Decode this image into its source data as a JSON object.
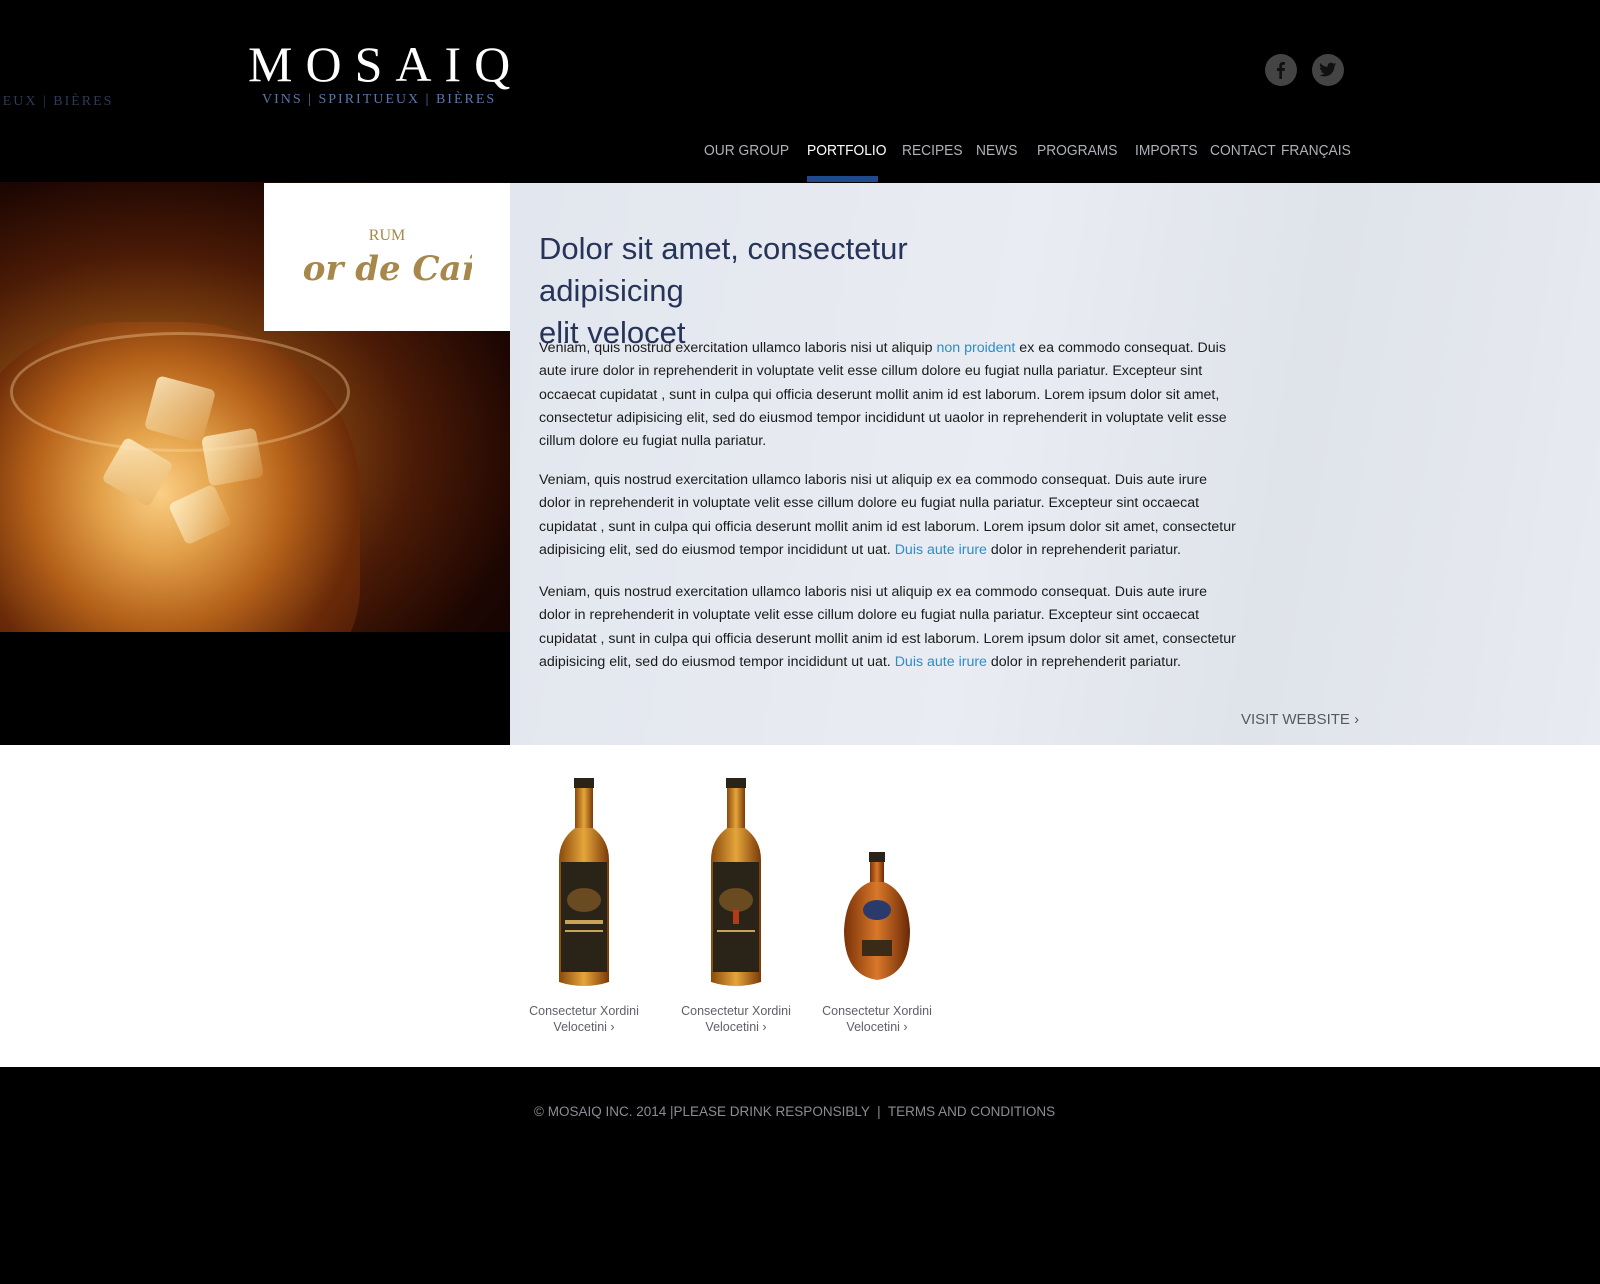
{
  "header": {
    "ghost_tagline": "IEUX | BIÈRES",
    "logo_word": "MOSAIQ",
    "logo_tagline": "VINS | SPIRITUEUX | BIÈRES",
    "social": [
      "facebook-icon",
      "twitter-icon"
    ]
  },
  "nav": {
    "items": [
      "OUR GROUP",
      "PORTFOLIO",
      "RECIPES",
      "NEWS",
      "PROGRAMS",
      "IMPORTS",
      "CONTACT",
      "FRANÇAIS"
    ],
    "active": "PORTFOLIO"
  },
  "brand": {
    "rum_label": "RUM",
    "name": "Flor de Caña",
    "color": "#a8874b"
  },
  "main": {
    "headline_line1": "Dolor sit amet, consectetur adipisicing",
    "headline_line2": "elit velocet",
    "p1_a": "Veniam, quis nostrud exercitation ullamco laboris nisi ut aliquip ",
    "p1_link": "non proident",
    "p1_b": " ex ea commodo consequat. Duis aute irure dolor in reprehenderit in voluptate velit esse cillum dolore eu fugiat nulla pariatur. Excepteur sint occaecat cupidatat , sunt in culpa qui officia deserunt mollit anim id est laborum. Lorem ipsum dolor sit amet, consectetur adipisicing elit, sed do eiusmod tempor incididunt ut uaolor in reprehenderit in voluptate velit esse cillum dolore eu fugiat nulla pariatur.",
    "p2_a": "Veniam, quis nostrud exercitation ullamco laboris nisi ut aliquip ex ea commodo consequat. Duis aute irure dolor in reprehenderit in voluptate velit esse cillum dolore eu fugiat nulla pariatur. Excepteur sint occaecat cupidatat , sunt in culpa qui officia deserunt mollit anim id est laborum. Lorem ipsum dolor sit amet, consectetur adipisicing elit, sed do eiusmod tempor incididunt ut uat. ",
    "p2_link": "Duis aute irure",
    "p2_b": " dolor in reprehenderit pariatur.",
    "p3_a": "Veniam, quis nostrud exercitation ullamco laboris nisi ut aliquip ex ea commodo consequat. Duis aute irure dolor in reprehenderit in voluptate velit esse cillum dolore eu fugiat nulla pariatur. Excepteur sint occaecat cupidatat , sunt in culpa qui officia deserunt mollit anim id est laborum. Lorem ipsum dolor sit amet, consectetur adipisicing elit, sed do eiusmod tempor incididunt ut uat. ",
    "p3_link": "Duis aute irure",
    "p3_b": " dolor in reprehenderit pariatur.",
    "visit_label": "VISIT WEBSITE ›",
    "link_color": "#2a8ec9",
    "headline_color": "#27345a"
  },
  "products": [
    {
      "line1": "Consectetur Xordini",
      "line2": "Velocetini ›"
    },
    {
      "line1": "Consectetur Xordini",
      "line2": "Velocetini ›"
    },
    {
      "line1": "Consectetur Xordini",
      "line2": "Velocetini ›"
    }
  ],
  "footer": {
    "copyright": "© MOSAIQ INC. 2014",
    "sep1": "  |",
    "drink": "PLEASE DRINK RESPONSIBLY",
    "sep2": "  |  ",
    "terms": "TERMS AND CONDITIONS"
  }
}
